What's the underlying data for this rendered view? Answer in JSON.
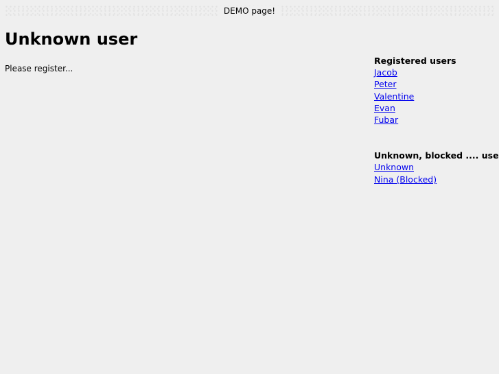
{
  "banner": {
    "text": "DEMO page!"
  },
  "main": {
    "title": "Unknown user",
    "message": "Please register..."
  },
  "sidebar": {
    "registered": {
      "heading": "Registered users",
      "items": [
        "Jacob",
        "Peter",
        "Valentine",
        "Evan",
        "Fubar"
      ]
    },
    "other": {
      "heading": "Unknown, blocked .... users.",
      "items": [
        "Unknown",
        "Nina (Blocked)"
      ]
    }
  }
}
